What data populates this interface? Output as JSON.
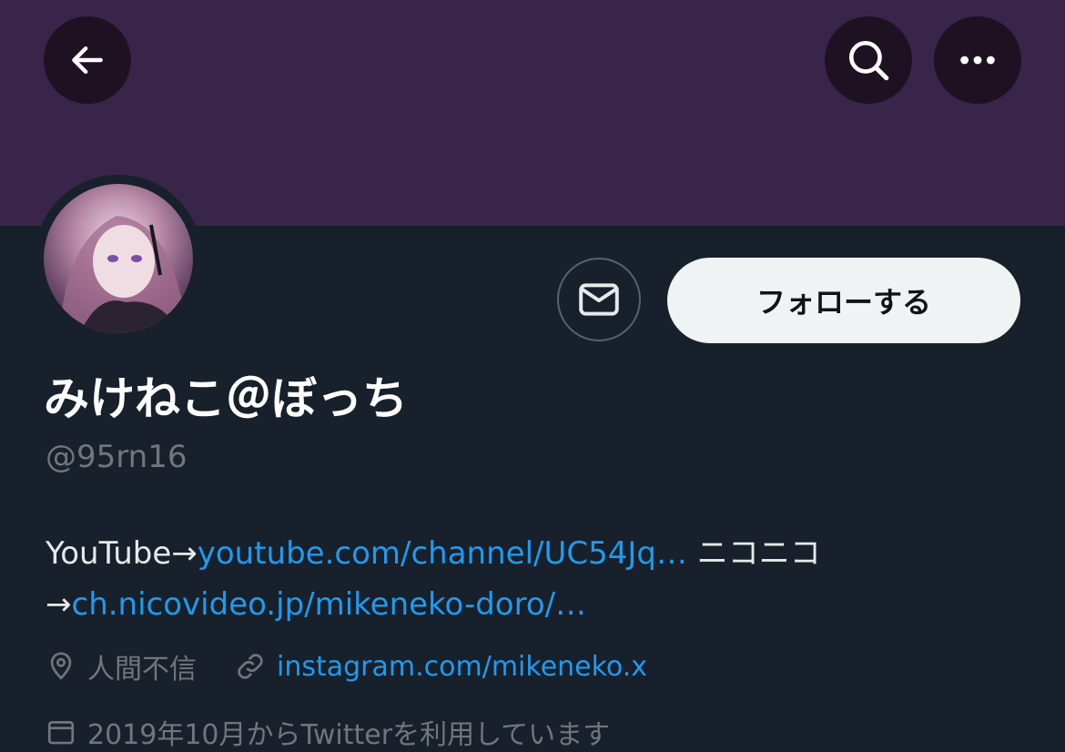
{
  "header": {
    "back_icon": "arrow-left-icon",
    "search_icon": "search-icon",
    "more_icon": "more-horizontal-icon",
    "banner_color": "#39254a"
  },
  "profile": {
    "display_name": "みけねこ＠ぼっち",
    "handle": "@95rn16",
    "follow_label": "フォローする",
    "message_icon": "mail-icon",
    "bio": {
      "prefix": "YouTube→",
      "link1": "youtube.com/channel/UC54Jq…",
      "middle": " ニコニコ→",
      "link2": "ch.nicovideo.jp/mikeneko-doro/…"
    },
    "location": "人間不信",
    "website": "instagram.com/mikeneko.x",
    "joined": "2019年10月からTwitterを利用しています"
  },
  "colors": {
    "background": "#18202b",
    "link": "#1d9bf0",
    "muted": "#71767b"
  }
}
